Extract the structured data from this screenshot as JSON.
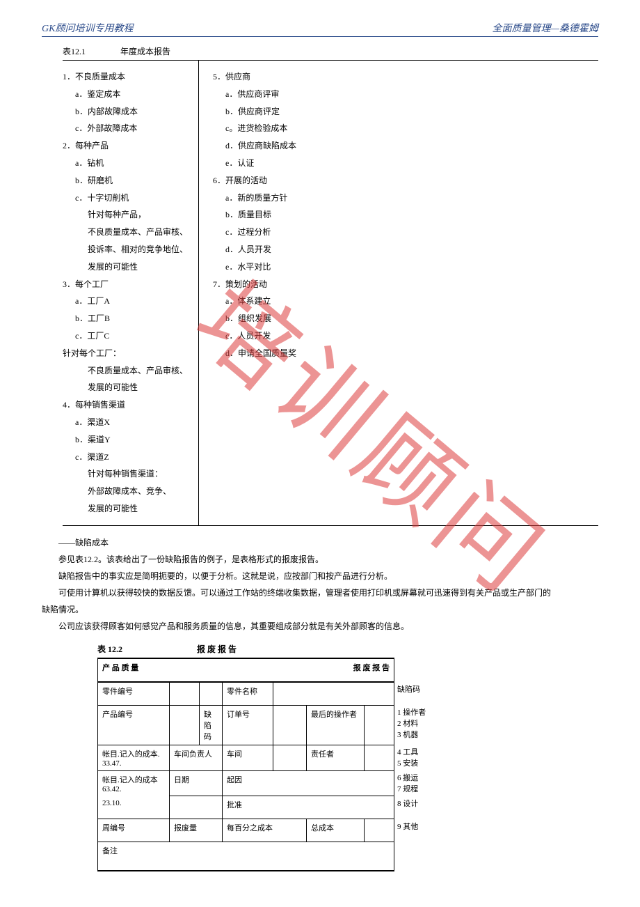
{
  "header": {
    "left": "GK顾问培训专用教程",
    "right": "全面质量管理—桑德霍姆"
  },
  "table12_1": {
    "number": "表12.1",
    "title": "年度成本报告",
    "left": [
      {
        "lvl": 1,
        "t": "1．不良质量成本"
      },
      {
        "lvl": 2,
        "t": "a．鉴定成本"
      },
      {
        "lvl": 2,
        "t": "b．内部故障成本"
      },
      {
        "lvl": 2,
        "t": "c．外部故障成本"
      },
      {
        "lvl": 1,
        "t": "2．每种产品"
      },
      {
        "lvl": 2,
        "t": "a．钻机"
      },
      {
        "lvl": 2,
        "t": "b．研磨机"
      },
      {
        "lvl": 2,
        "t": "c．十字切削机"
      },
      {
        "lvl": 3,
        "t": "针对每种产品，"
      },
      {
        "lvl": 3,
        "t": "不良质量成本、产品审核、"
      },
      {
        "lvl": 3,
        "t": "投诉率、相对的竞争地位、"
      },
      {
        "lvl": 3,
        "t": "发展的可能性"
      },
      {
        "lvl": 1,
        "t": "3．每个工厂"
      },
      {
        "lvl": 2,
        "t": "a．工厂A"
      },
      {
        "lvl": 2,
        "t": "b．工厂B"
      },
      {
        "lvl": 2,
        "t": "c．工厂C"
      },
      {
        "lvl": 1,
        "t": "针对每个工厂："
      },
      {
        "lvl": 3,
        "t": "不良质量成本、产品审核、"
      },
      {
        "lvl": 3,
        "t": "发展的可能性"
      },
      {
        "lvl": 1,
        "t": "4．每种销售渠道"
      },
      {
        "lvl": 2,
        "t": "a．渠道X"
      },
      {
        "lvl": 2,
        "t": "b．渠道Y"
      },
      {
        "lvl": 2,
        "t": "c．渠道Z"
      },
      {
        "lvl": 3,
        "t": "针对每种销售渠道："
      },
      {
        "lvl": 3,
        "t": "外部故障成本、竞争、"
      },
      {
        "lvl": 3,
        "t": "发展的可能性"
      }
    ],
    "right": [
      {
        "lvl": 1,
        "t": "5．供应商"
      },
      {
        "lvl": 2,
        "t": "a．供应商评审"
      },
      {
        "lvl": 2,
        "t": "b．供应商评定"
      },
      {
        "lvl": 2,
        "t": "c。进货检验成本"
      },
      {
        "lvl": 2,
        "t": "d．供应商缺陷成本"
      },
      {
        "lvl": 2,
        "t": "e．认证"
      },
      {
        "lvl": 1,
        "t": "6．开展的活动"
      },
      {
        "lvl": 2,
        "t": "a．新的质量方针"
      },
      {
        "lvl": 2,
        "t": "b．质量目标"
      },
      {
        "lvl": 2,
        "t": "c．过程分析"
      },
      {
        "lvl": 2,
        "t": "d．人员开发"
      },
      {
        "lvl": 2,
        "t": "e．水平对比"
      },
      {
        "lvl": 1,
        "t": "7．策划的活动"
      },
      {
        "lvl": 2,
        "t": "a．体系建立"
      },
      {
        "lvl": 2,
        "t": "b．组织发展"
      },
      {
        "lvl": 2,
        "t": "c．人员开发"
      },
      {
        "lvl": 2,
        "t": "d．申请全国质量奖"
      }
    ]
  },
  "paras": {
    "p1": "——缺陷成本",
    "p2": "参见表12.2。该表给出了一份缺陷报告的例子，是表格形式的报废报告。",
    "p3": "缺陷报告中的事实应是简明扼要的，以便于分析。这就是说，应按部门和按产品进行分析。",
    "p4": "可使用计算机以获得较快的数据反馈。可以通过工作站的终端收集数据，管理者使用打印机或屏幕就可迅速得到有关产品或生产部门的",
    "p4b": "缺陷情况。",
    "p5": "公司应该获得顾客如何感觉产品和服务质量的信息，其重要组成部分就是有关外部顾客的信息。"
  },
  "table12_2": {
    "number": "表 12.2",
    "title": "报 废 报 告",
    "row_title_left": "产 品 质 量",
    "row_title_right": "报 废 报 告",
    "labels": {
      "part_no": "零件编号",
      "part_name": "零件名称",
      "product_no": "产品编号",
      "defect_code": "缺陷码",
      "order_no": "订单号",
      "last_operator": "最后的操作者",
      "acct1": "帐目.记入的成本.\n33.47.",
      "shop_resp": "车间负责人",
      "shop": "车间",
      "responsible": "责任者",
      "acct2": "帐目.记入的成本\n63.42.",
      "date": "日期",
      "cause": "起因",
      "acct3": "23.10.",
      "approve": "批准",
      "week_no": "周编号",
      "scrap_qty": "报废量",
      "cost_per_100": "每百分之成本",
      "total_cost": "总成本",
      "remark": "备注"
    },
    "side": {
      "title": "缺陷码",
      "items": [
        "1  操作者",
        "2  材料",
        "3  机器",
        "4  工具",
        "5  安装",
        "6  搬运",
        "7  规程",
        "8  设计",
        "9  其他"
      ]
    }
  },
  "watermark": "培训顾问"
}
